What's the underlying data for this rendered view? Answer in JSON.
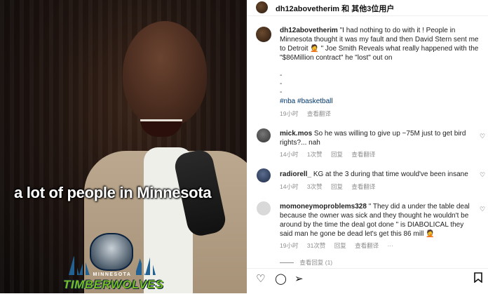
{
  "video": {
    "caption": "a lot of people in Minnesota",
    "logo": {
      "top": "MINNESOTA",
      "name": "TIMBERWOLVES"
    }
  },
  "header": {
    "title": "dh12abovetherim 和 其他3位用户"
  },
  "post": {
    "username": "dh12abovetherim",
    "caption": "\"I had nothing to do with it ! People in Minnesota thought it was my fault and then David Stern sent me to Detroit 🤦 \" Joe Smith Reveals what really happened with the \"$86Million contract\" he \"lost\" out on",
    "dashes": [
      "-",
      "-",
      "-"
    ],
    "tags": "#nba #basketball",
    "time": "19小时",
    "translate": "查看翻译"
  },
  "comments": [
    {
      "user": "mick.mos",
      "text": "So he was willing to give up ~75M just to get bird rights?... nah",
      "time": "14小时",
      "likes": "1次赞",
      "reply": "回复",
      "translate": "查看翻译"
    },
    {
      "user": "radiorell_",
      "text": "KG at the 3 during that time would've been insane",
      "time": "14小时",
      "likes": "3次赞",
      "reply": "回复",
      "translate": "查看翻译"
    },
    {
      "user": "momoneymoproblems328",
      "text": "\" They did a under the table deal because the owner was sick and they thought he wouldn't be around by the time the deal got done \" is DIABOLICAL they said man he gone be dead let's get this 86 mill 🤦",
      "time": "19小时",
      "likes": "31次赞",
      "reply": "回复",
      "translate": "查看翻译",
      "more": "···"
    }
  ],
  "view_replies": "查看回复 (1)",
  "icons": {
    "like": "heart-icon",
    "comment": "comment-icon",
    "share": "send-icon",
    "save": "bookmark-icon"
  },
  "colors": {
    "tag": "#00376b",
    "meta": "#8e8e8e"
  }
}
